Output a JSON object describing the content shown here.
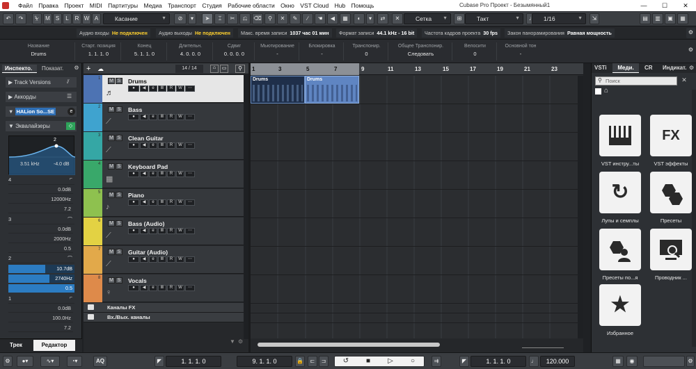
{
  "menu": [
    "Файл",
    "Правка",
    "Проект",
    "MIDI",
    "Партитуры",
    "Медиа",
    "Транспорт",
    "Студия",
    "Рабочие области",
    "Окно",
    "VST Cloud",
    "Hub",
    "Помощь"
  ],
  "window_title": "Cubase Pro Проект - Безымянный1",
  "window_buttons": [
    "—",
    "☐",
    "✕"
  ],
  "toolbar": {
    "mode_letters": [
      "M",
      "S",
      "L",
      "R",
      "W",
      "A"
    ],
    "automation_mode": "Касание",
    "snap_type": "Сетка",
    "grid_type": "Такт",
    "quantize": "1/16"
  },
  "status": {
    "audio_in_label": "Аудио входы",
    "audio_in_value": "Не подключен",
    "audio_out_label": "Аудио выходы",
    "audio_out_value": "Не подключен",
    "rec_time_label": "Макс. время записи",
    "rec_time_value": "1037 час 01 мин",
    "rec_format_label": "Формат записи",
    "rec_format_value": "44.1 kHz - 16 bit",
    "fps_label": "Частота кадров проекта",
    "fps_value": "30 fps",
    "pan_label": "Закон панорамирования",
    "pan_value": "Равная мощность"
  },
  "infoline": [
    {
      "h": "Название",
      "v": "Drums"
    },
    {
      "h": "Старт. позиция",
      "v": "1. 1. 1. 0"
    },
    {
      "h": "Конец",
      "v": "5. 1. 1. 0"
    },
    {
      "h": "Длительн.",
      "v": "4. 0. 0. 0"
    },
    {
      "h": "Сдвиг",
      "v": "0. 0. 0. 0"
    },
    {
      "h": "Мьютирование",
      "v": "-"
    },
    {
      "h": "Блокировка",
      "v": "-"
    },
    {
      "h": "Транспонир.",
      "v": "0"
    },
    {
      "h": "Общее Транспонир.",
      "v": "Следовать"
    },
    {
      "h": "Велосити",
      "v": "0"
    },
    {
      "h": "Основной тон",
      "v": "-"
    }
  ],
  "inspector": {
    "tabs": [
      "Инспекто.",
      "Показат."
    ],
    "sections": [
      "Track Versions",
      "Аккорды",
      "HALion So...SE",
      "Эквалайзеры"
    ],
    "eq_freq": "3.51 kHz",
    "eq_gain": "-4.0 dB",
    "eq_band_marker": "2",
    "bands": [
      {
        "n": "4",
        "rows": [
          "0.0dB",
          "12000Hz",
          "7.2"
        ]
      },
      {
        "n": "3",
        "rows": [
          "0.0dB",
          "2000Hz",
          "0.5"
        ]
      },
      {
        "n": "2",
        "rows": [
          "10.7dB",
          "2740Hz",
          "0.5"
        ],
        "active": true
      },
      {
        "n": "1",
        "rows": [
          "0.0dB",
          "100.0Hz",
          "7.2"
        ]
      }
    ],
    "bottom_tabs": [
      "Трек",
      "Редактор"
    ]
  },
  "tracklist": {
    "counter": "14 / 14",
    "tracks": [
      {
        "n": "1",
        "name": "Drums",
        "color": "#4d73b3",
        "selected": true
      },
      {
        "n": "2",
        "name": "Bass",
        "color": "#3fa3cf"
      },
      {
        "n": "3",
        "name": "Clean Guitar",
        "color": "#35a7a5"
      },
      {
        "n": "4",
        "name": "Keyboard Pad",
        "color": "#39a86a"
      },
      {
        "n": "5",
        "name": "Piano",
        "color": "#8ec14f"
      },
      {
        "n": "6",
        "name": "Bass (Audio)",
        "color": "#e3d243"
      },
      {
        "n": "7",
        "name": "Guitar (Audio)",
        "color": "#e2a94a"
      },
      {
        "n": "8",
        "name": "Vocals",
        "color": "#de8a4a"
      }
    ],
    "folders": [
      "Каналы FX",
      "Вх./Вых. каналы"
    ]
  },
  "ruler": [
    "1",
    "3",
    "5",
    "7",
    "9",
    "11",
    "13",
    "15",
    "17",
    "19",
    "21",
    "23"
  ],
  "parts": [
    {
      "label": "Drums"
    },
    {
      "label": "Drums"
    }
  ],
  "right_zone": {
    "tabs": [
      "VSTi",
      "Меди.",
      "CR",
      "Индикат."
    ],
    "search_placeholder": "Поиск",
    "tiles": [
      {
        "icon": "piano-icon",
        "label": "VST инстру...ты"
      },
      {
        "icon": "fx-icon",
        "glyph": "FX",
        "label": "VST эффекты"
      },
      {
        "icon": "loop-icon",
        "label": "Лупы и семплы"
      },
      {
        "icon": "presets-icon",
        "label": "Пресеты"
      },
      {
        "icon": "user-presets-icon",
        "label": "Пресеты по...я"
      },
      {
        "icon": "browser-icon",
        "label": "Проводник ..."
      },
      {
        "icon": "star-icon",
        "label": "Избранное"
      }
    ]
  },
  "transport": {
    "aq": "AQ",
    "left_locator": "1. 1. 1. 0",
    "right_locator": "9. 1. 1. 0",
    "position": "1. 1. 1. 0",
    "tempo": "120.000"
  }
}
